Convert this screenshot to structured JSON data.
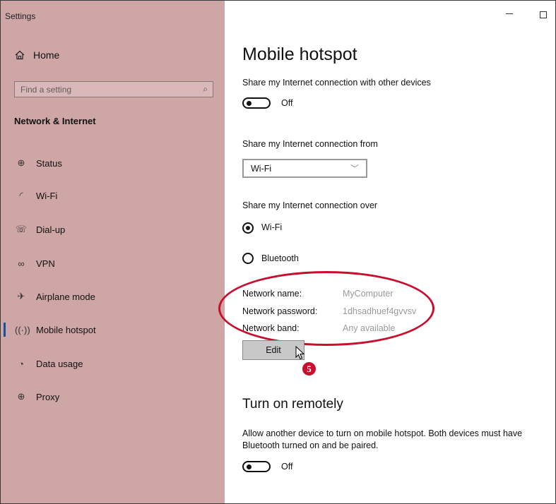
{
  "window": {
    "title": "Settings"
  },
  "sidebar": {
    "home_label": "Home",
    "home_icon": "home-icon",
    "search_placeholder": "Find a setting",
    "section_title": "Network & Internet",
    "items": [
      {
        "label": "Status",
        "icon": "globe-status-icon",
        "active": false
      },
      {
        "label": "Wi-Fi",
        "icon": "wifi-icon",
        "active": false
      },
      {
        "label": "Dial-up",
        "icon": "phone-icon",
        "active": false
      },
      {
        "label": "VPN",
        "icon": "vpn-icon",
        "active": false
      },
      {
        "label": "Airplane mode",
        "icon": "airplane-icon",
        "active": false
      },
      {
        "label": "Mobile hotspot",
        "icon": "hotspot-icon",
        "active": true
      },
      {
        "label": "Data usage",
        "icon": "data-usage-icon",
        "active": false
      },
      {
        "label": "Proxy",
        "icon": "globe-icon",
        "active": false
      }
    ]
  },
  "main": {
    "title": "Mobile hotspot",
    "share_label": "Share my Internet connection with other devices",
    "share_toggle_state": "Off",
    "from_label": "Share my Internet connection from",
    "from_value": "Wi-Fi",
    "over_label": "Share my Internet connection over",
    "over_options": [
      {
        "label": "Wi-Fi",
        "selected": true
      },
      {
        "label": "Bluetooth",
        "selected": false
      }
    ],
    "network_info": [
      {
        "label": "Network name:",
        "value": "MyComputer"
      },
      {
        "label": "Network password:",
        "value": "1dhsadhuef4gvvsv"
      },
      {
        "label": "Network band:",
        "value": "Any available"
      }
    ],
    "edit_button": "Edit",
    "step_marker": "5",
    "remote_title": "Turn on remotely",
    "remote_desc": "Allow another device to turn on mobile hotspot. Both devices must have Bluetooth turned on and be paired.",
    "remote_toggle_state": "Off"
  },
  "colors": {
    "sidebar_bg": "#cfa6a6",
    "annotation": "#c8102e",
    "accent": "#1a4f9c"
  }
}
